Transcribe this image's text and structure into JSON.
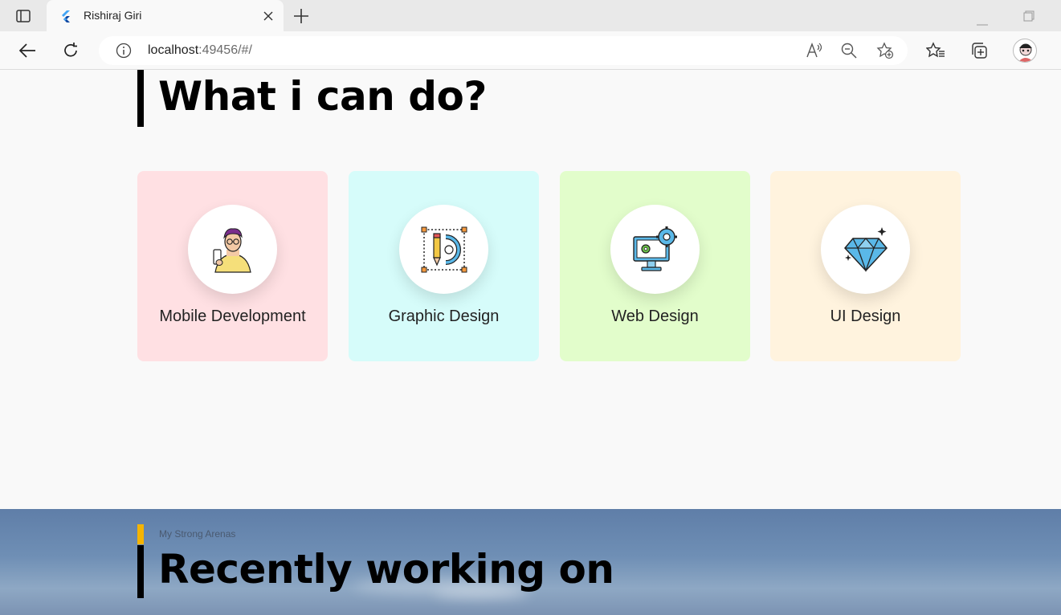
{
  "browser": {
    "tab_title": "Rishiraj Giri",
    "url_host": "localhost",
    "url_rest": ":49456/#/"
  },
  "icons": {
    "tab_actions": "tab-actions-icon",
    "favicon": "flutter-favicon-icon",
    "close": "close-icon",
    "new_tab": "plus-icon",
    "minimize": "minimize-icon",
    "restore": "restore-icon",
    "back": "back-arrow-icon",
    "refresh": "refresh-icon",
    "info": "info-icon",
    "read_aloud": "read-aloud-icon",
    "zoom_out": "zoom-out-icon",
    "add_favorite": "add-favorite-icon",
    "favorites": "favorites-icon",
    "collections": "collections-icon",
    "profile": "profile-avatar-icon"
  },
  "services": {
    "heading": "What i can do?",
    "cards": [
      {
        "label": "Mobile Development",
        "color": "#ffe0e3",
        "icon": "person-with-phone-icon"
      },
      {
        "label": "Graphic Design",
        "color": "#d6fcfa",
        "icon": "pencil-gear-icon"
      },
      {
        "label": "Web Design",
        "color": "#e2fdcb",
        "icon": "monitor-gears-icon"
      },
      {
        "label": "UI Design",
        "color": "#fff3de",
        "icon": "diamond-icon"
      }
    ]
  },
  "recent": {
    "kicker": "My Strong Arenas",
    "heading": "Recently working on"
  },
  "colors": {
    "accent": "#f5b400",
    "heading": "#000000"
  }
}
